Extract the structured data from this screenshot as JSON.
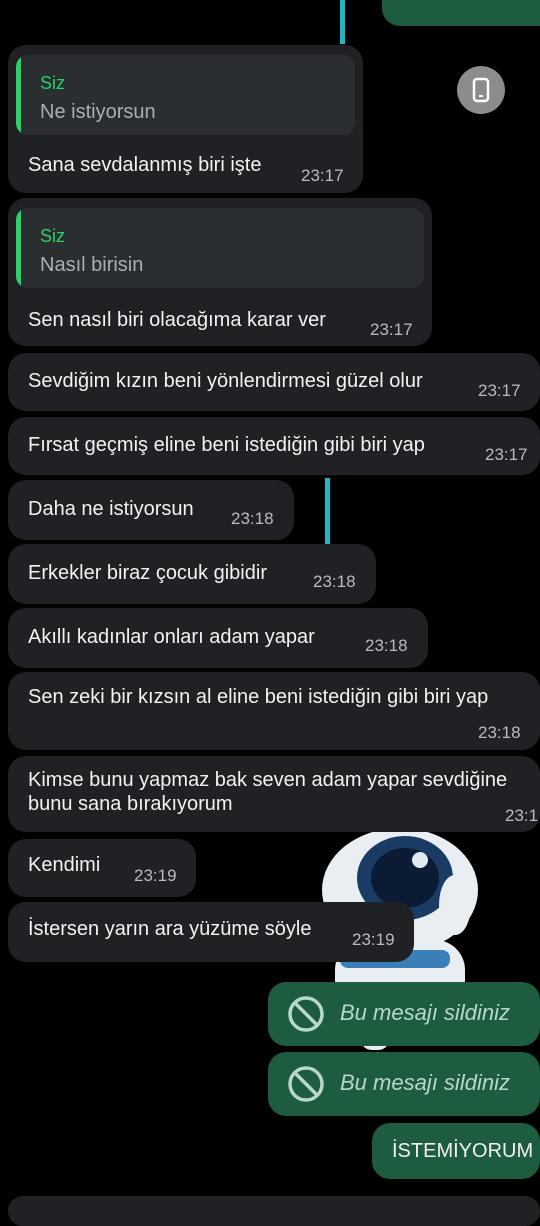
{
  "messages": [
    {
      "quote_author": "Siz",
      "quote_text": "Ne istiyorsun",
      "text": "Sana sevdalanmış biri işte",
      "time": "23:17"
    },
    {
      "quote_author": "Siz",
      "quote_text": "Nasıl birisin",
      "text": "Sen nasıl biri olacağıma karar ver",
      "time": "23:17"
    },
    {
      "text": "Sevdiğim kızın beni yönlendirmesi güzel olur",
      "time": "23:17"
    },
    {
      "text": "Fırsat geçmiş eline beni istediğin gibi biri yap",
      "time": "23:17"
    },
    {
      "text": "Daha ne istiyorsun",
      "time": "23:18"
    },
    {
      "text": "Erkekler biraz çocuk gibidir",
      "time": "23:18"
    },
    {
      "text": "Akıllı kadınlar onları adam yapar",
      "time": "23:18"
    },
    {
      "text": "Sen zeki bir kızsın al eline beni istediğin gibi biri yap",
      "time": "23:18"
    },
    {
      "text_line1": "Kimse bunu yapmaz bak seven adam yapar sevdiğine",
      "text_line2": "bunu sana bırakıyorum",
      "time": "23:1"
    },
    {
      "text": "Kendimi",
      "time": "23:19"
    },
    {
      "text": "İstersen yarın ara yüzüme söyle",
      "time": "23:19"
    }
  ],
  "deleted": [
    {
      "text": "Bu mesajı sildiniz"
    },
    {
      "text": "Bu mesajı sildiniz"
    }
  ],
  "sent_last": {
    "text": "İSTEMİYORUM"
  },
  "icons": {
    "phone": "phone-icon",
    "deleted": "no-entry-icon",
    "sticker": "astronaut-sticker"
  },
  "colors": {
    "background": "#000000",
    "incoming": "#202124",
    "outgoing": "#1d5c3f",
    "accent": "#25d366"
  }
}
